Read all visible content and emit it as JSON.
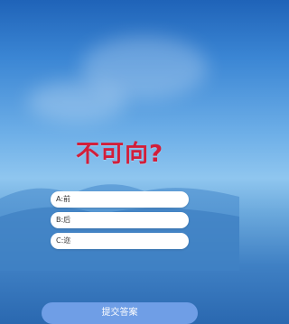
{
  "quiz": {
    "question": "不可向?",
    "options": [
      {
        "label": "A:前"
      },
      {
        "label": "B:后"
      },
      {
        "label": "C:迩"
      }
    ],
    "submit_label": "提交答案"
  },
  "colors": {
    "question_text": "#d21e3a",
    "submit_bg": "#6f9ee6",
    "sky_top": "#1f63b8"
  }
}
